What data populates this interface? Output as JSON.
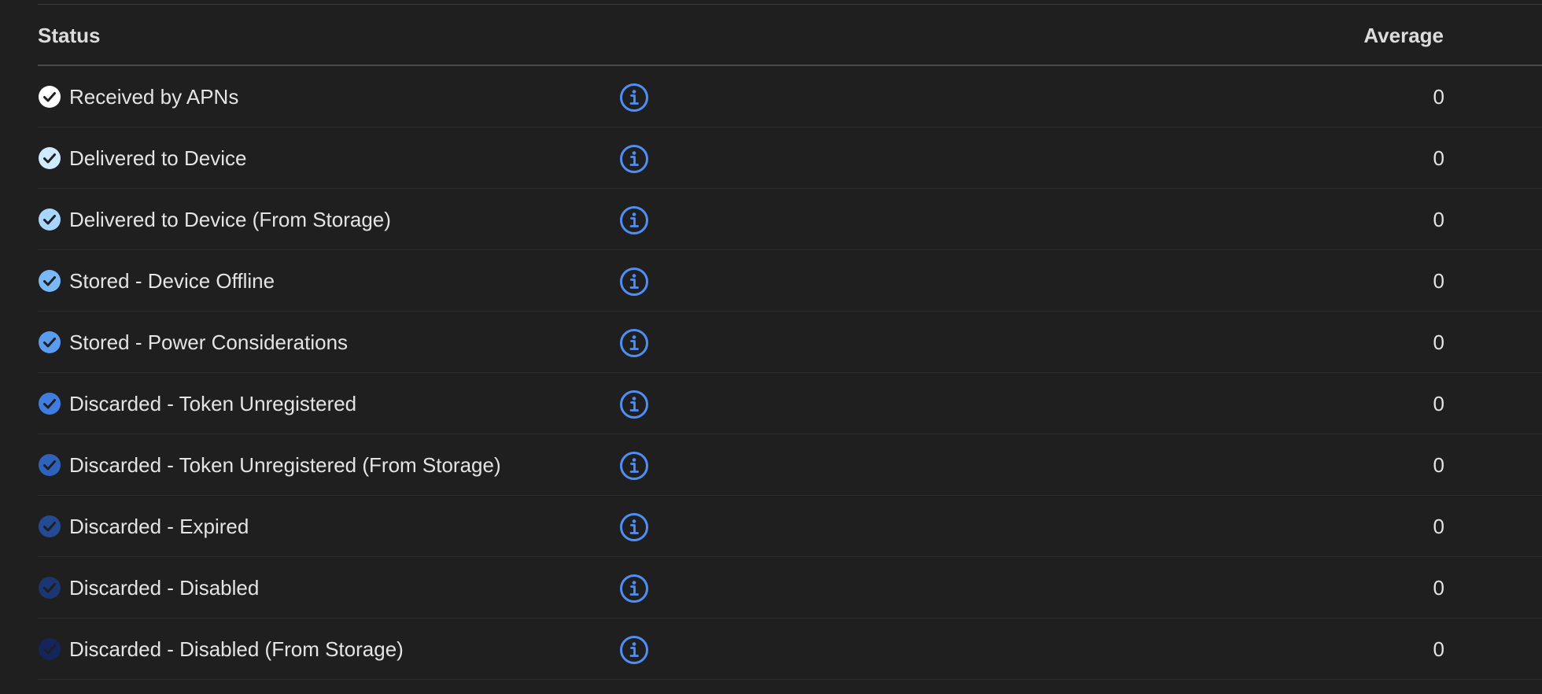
{
  "table": {
    "headers": {
      "status": "Status",
      "average": "Average"
    },
    "rows": [
      {
        "label": "Received by APNs",
        "average": "0",
        "color": "#ffffff",
        "check": "#1f1f1f"
      },
      {
        "label": "Delivered to Device",
        "average": "0",
        "color": "#cfe9ff",
        "check": "#1f1f1f"
      },
      {
        "label": "Delivered to Device (From Storage)",
        "average": "0",
        "color": "#a9d6ff",
        "check": "#1f1f1f"
      },
      {
        "label": "Stored - Device Offline",
        "average": "0",
        "color": "#7ab8f7",
        "check": "#1f1f1f"
      },
      {
        "label": "Stored - Power Considerations",
        "average": "0",
        "color": "#5a9cf0",
        "check": "#1f1f1f"
      },
      {
        "label": "Discarded - Token Unregistered",
        "average": "0",
        "color": "#3f7ee0",
        "check": "#1f1f1f"
      },
      {
        "label": "Discarded - Token Unregistered (From Storage)",
        "average": "0",
        "color": "#2f62bd",
        "check": "#1f1f1f"
      },
      {
        "label": "Discarded - Expired",
        "average": "0",
        "color": "#244a94",
        "check": "#1f1f1f"
      },
      {
        "label": "Discarded - Disabled",
        "average": "0",
        "color": "#1b3670",
        "check": "#1f1f1f"
      },
      {
        "label": "Discarded - Disabled (From Storage)",
        "average": "0",
        "color": "#13255a",
        "check": "#1f1f1f"
      }
    ],
    "info_icon": "info-circle-icon",
    "status_icon": "checkmark-circle-icon",
    "accent": "#4f8ff5"
  }
}
